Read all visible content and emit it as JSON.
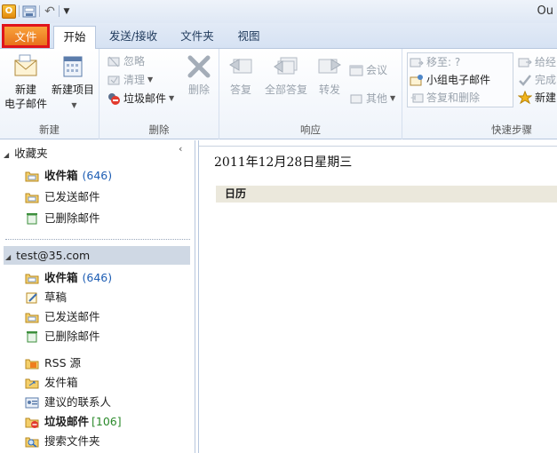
{
  "titlebar": {
    "title": "Ou",
    "app_icon_letter": "O"
  },
  "tabs": {
    "file": "文件",
    "home": "开始",
    "send_receive": "发送/接收",
    "folder": "文件夹",
    "view": "视图"
  },
  "ribbon": {
    "new_group": {
      "label": "新建",
      "new_email": [
        "新建",
        "电子邮件"
      ],
      "new_items": "新建项目"
    },
    "delete_group": {
      "label": "删除",
      "ignore": "忽略",
      "clean": "清理",
      "junk": "垃圾邮件",
      "delete": "删除"
    },
    "respond_group": {
      "label": "响应",
      "reply": "答复",
      "reply_all": "全部答复",
      "forward": "转发",
      "meeting": "会议",
      "more": "其他"
    },
    "quicksteps_group": {
      "label": "快速步骤",
      "move_to": "移至: ?",
      "team_email": "小组电子邮件",
      "reply_delete": "答复和删除",
      "to_manager": "给经",
      "done": "完成",
      "create_new": "新建"
    }
  },
  "nav": {
    "favorites": {
      "label": "收藏夹",
      "items": [
        {
          "label": "收件箱",
          "count": "(646)"
        },
        {
          "label": "已发送邮件"
        },
        {
          "label": "已删除邮件"
        }
      ]
    },
    "account": {
      "label": "test@35.com",
      "items": [
        {
          "label": "收件箱",
          "count": "(646)"
        },
        {
          "label": "草稿"
        },
        {
          "label": "已发送邮件"
        },
        {
          "label": "已删除邮件"
        },
        {
          "label": "RSS 源"
        },
        {
          "label": "发件箱"
        },
        {
          "label": "建议的联系人"
        },
        {
          "label": "垃圾邮件",
          "count": "[106]"
        },
        {
          "label": "搜索文件夹"
        }
      ]
    }
  },
  "content": {
    "date": "2011年12月28日星期三",
    "section": "日历"
  },
  "colors": {
    "file_tab": "#e8711d",
    "file_tab_border": "#e0141c",
    "count_blue": "#1e5eb4",
    "count_green": "#2b8a2b"
  }
}
